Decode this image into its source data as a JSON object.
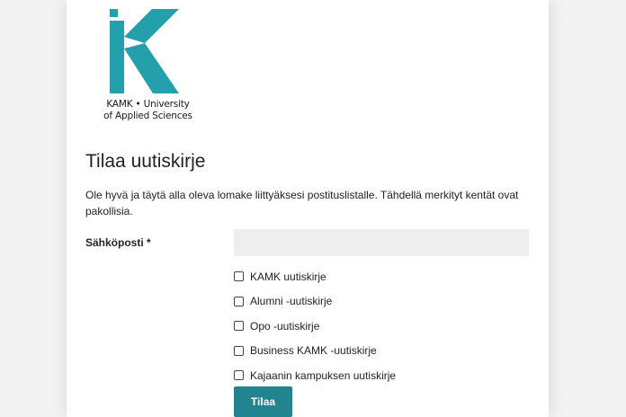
{
  "brand": {
    "logo_line1": "KAMK • University",
    "logo_line2": "of Applied Sciences",
    "accent_color": "#23a0ac"
  },
  "form": {
    "title": "Tilaa uutiskirje",
    "intro": "Ole hyvä ja täytä alla oleva lomake liittyäksesi postituslistalle. Tähdellä merkityt kentät ovat pakollisia.",
    "email_label": "Sähköposti *",
    "email_value": "",
    "lists": [
      {
        "label": "KAMK uutiskirje",
        "checked": false
      },
      {
        "label": "Alumni -uutiskirje",
        "checked": false
      },
      {
        "label": "Opo -uutiskirje",
        "checked": false
      },
      {
        "label": "Business KAMK -uutiskirje",
        "checked": false
      },
      {
        "label": "Kajaanin kampuksen uutiskirje",
        "checked": false
      }
    ],
    "submit_label": "Tilaa",
    "button_color": "#22848f"
  }
}
